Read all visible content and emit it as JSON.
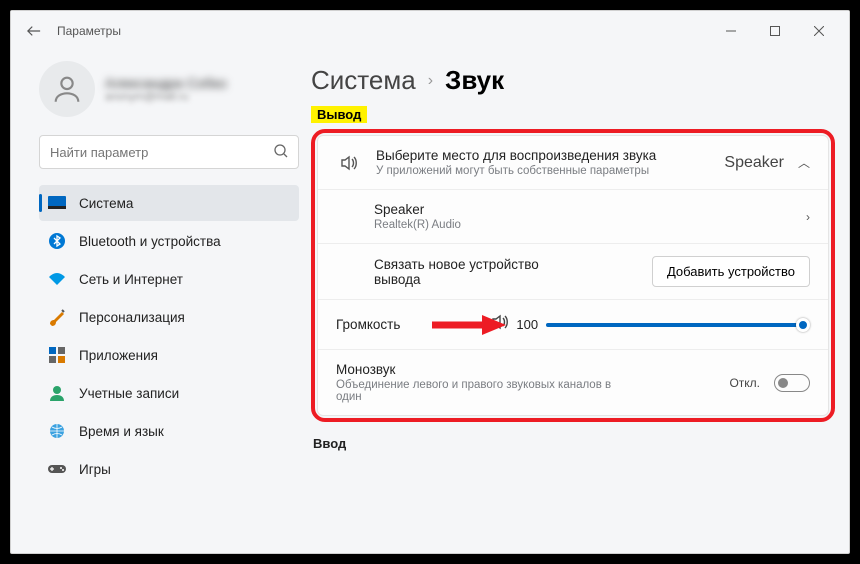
{
  "titlebar": {
    "title": "Параметры"
  },
  "profile": {
    "name": "Александра Собко",
    "email": "anonym@mail.ru"
  },
  "search": {
    "placeholder": "Найти параметр"
  },
  "sidebar": {
    "items": [
      {
        "label": "Система"
      },
      {
        "label": "Bluetooth и устройства"
      },
      {
        "label": "Сеть и Интернет"
      },
      {
        "label": "Персонализация"
      },
      {
        "label": "Приложения"
      },
      {
        "label": "Учетные записи"
      },
      {
        "label": "Время и язык"
      },
      {
        "label": "Игры"
      }
    ]
  },
  "breadcrumb": {
    "parent": "Система",
    "current": "Звук"
  },
  "section_output": "Вывод",
  "output_picker": {
    "title": "Выберите место для воспроизведения звука",
    "sub": "У приложений могут быть собственные параметры",
    "selected": "Speaker"
  },
  "device": {
    "name": "Speaker",
    "driver": "Realtek(R) Audio"
  },
  "pair": {
    "title": "Связать новое устройство вывода",
    "button": "Добавить устройство"
  },
  "volume": {
    "label": "Громкость",
    "value": "100"
  },
  "mono": {
    "title": "Монозвук",
    "sub": "Объединение левого и правого звуковых каналов в один",
    "state": "Откл."
  },
  "section_input": "Ввод"
}
